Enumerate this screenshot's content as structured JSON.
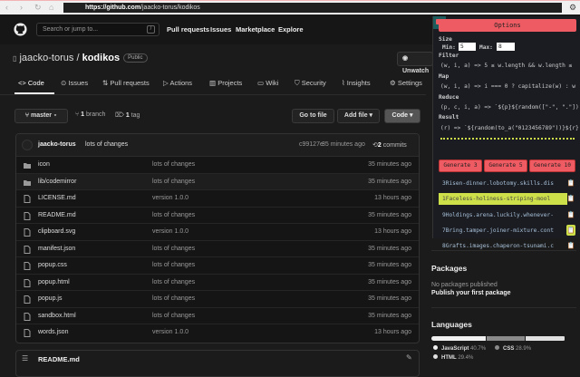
{
  "browser": {
    "url_host": "https://github.com",
    "url_path": "/jaacko-torus/kodikos"
  },
  "header": {
    "search_placeholder": "Search or jump to...",
    "slash": "/",
    "nav": [
      "Pull requests",
      "Issues",
      "Marketplace",
      "Explore"
    ]
  },
  "repo": {
    "owner": "jaacko-torus",
    "sep": "/",
    "name": "kodikos",
    "visibility": "Public",
    "unwatch": "Unwatch"
  },
  "tabs": [
    "Code",
    "Issues",
    "Pull requests",
    "Actions",
    "Projects",
    "Wiki",
    "Security",
    "Insights",
    "Settings"
  ],
  "branchbar": {
    "branch": "master",
    "branches_count": "1",
    "branches_label": "branch",
    "tags_count": "1",
    "tags_label": "tag",
    "go_to_file": "Go to file",
    "add_file": "Add file",
    "code": "Code"
  },
  "commit": {
    "author": "jaacko-torus",
    "message": "lots of changes",
    "hash": "c99127e",
    "age": "35 minutes ago",
    "commits_count": "2",
    "commits_label": "commits"
  },
  "files": [
    {
      "name": "icon",
      "type": "dir",
      "msg": "lots of changes",
      "age": "35 minutes ago"
    },
    {
      "name": "lib/codemirror",
      "type": "dir",
      "msg": "lots of changes",
      "age": "35 minutes ago"
    },
    {
      "name": "LICENSE.md",
      "type": "file",
      "msg": "version 1.0.0",
      "age": "13 hours ago"
    },
    {
      "name": "README.md",
      "type": "file",
      "msg": "lots of changes",
      "age": "35 minutes ago"
    },
    {
      "name": "clipboard.svg",
      "type": "file",
      "msg": "version 1.0.0",
      "age": "13 hours ago"
    },
    {
      "name": "manifest.json",
      "type": "file",
      "msg": "lots of changes",
      "age": "35 minutes ago"
    },
    {
      "name": "popup.css",
      "type": "file",
      "msg": "lots of changes",
      "age": "35 minutes ago"
    },
    {
      "name": "popup.html",
      "type": "file",
      "msg": "lots of changes",
      "age": "35 minutes ago"
    },
    {
      "name": "popup.js",
      "type": "file",
      "msg": "lots of changes",
      "age": "35 minutes ago"
    },
    {
      "name": "sandbox.html",
      "type": "file",
      "msg": "lots of changes",
      "age": "35 minutes ago"
    },
    {
      "name": "words.json",
      "type": "file",
      "msg": "version 1.0.0",
      "age": "13 hours ago"
    }
  ],
  "readme": {
    "title": "README.md"
  },
  "sidebar": {
    "packages_title": "Packages",
    "packages_none": "No packages published",
    "packages_link": "Publish your first package",
    "languages_title": "Languages",
    "languages": [
      {
        "name": "JavaScript",
        "pct": "40.7%",
        "value": 40.7,
        "color": "#f0f0f0"
      },
      {
        "name": "CSS",
        "pct": "28.9%",
        "value": 28.9,
        "color": "#8a8a8a"
      },
      {
        "name": "HTML",
        "pct": "29.4%",
        "value": 29.4,
        "color": "#e0e0e0"
      }
    ]
  },
  "popup": {
    "title": "Options",
    "size_label": "Size",
    "min_label": "Min:",
    "min_value": "5",
    "max_label": "Max:",
    "max_value": "8",
    "filter_label": "Filter",
    "filter_code": "(w, i, a) => 5 ≤ w.length && w.length ≤",
    "map_label": "Map",
    "map_code": "(w, i, a) => i === 0 ? capitalize(w) : w",
    "reduce_label": "Reduce",
    "reduce_code": "(p, c, i, a) => `${p}${random([\"-\", \".\"])}",
    "result_label": "Result",
    "result_code": "(r) => `${random(to_a(\"0123456789\"))}${r}",
    "buttons": [
      "Generate 3",
      "Generate 5",
      "Generate 10"
    ],
    "results": [
      "3Risen-dinner.lobotomy.skills.dis",
      "1Faceless-holiness-striping-mool",
      "9Holdings.arena.luckily.whenever-",
      "7Bring.tamper.joiner-mixture.cont",
      "8Grafts.images.chaperon-tsunami.c"
    ],
    "highlighted_index": 1,
    "accent": "#ef5b62",
    "highlight": "#cde04a"
  }
}
